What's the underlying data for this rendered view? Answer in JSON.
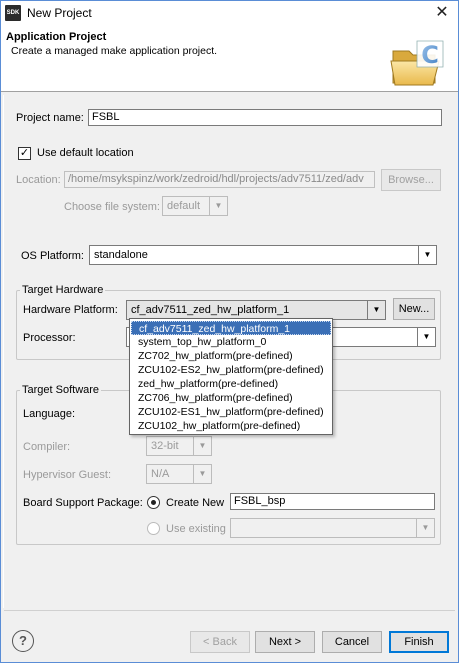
{
  "window": {
    "app_icon_text": "SDK",
    "title": "New Project"
  },
  "header": {
    "title": "Application Project",
    "description": "Create a managed make application project."
  },
  "project": {
    "name_label": "Project name:",
    "name_value": "FSBL",
    "use_default_label": "Use default location",
    "use_default_checked": true,
    "location_label": "Location:",
    "location_value": "/home/msykspinz/work/zedroid/hdl/projects/adv7511/zed/adv",
    "browse_label": "Browse...",
    "filesystem_label": "Choose file system:",
    "filesystem_value": "default"
  },
  "os": {
    "label": "OS Platform:",
    "value": "standalone"
  },
  "target_hardware": {
    "title": "Target Hardware",
    "hw_platform_label": "Hardware Platform:",
    "hw_platform_value": "cf_adv7511_zed_hw_platform_1",
    "new_button": "New...",
    "processor_label": "Processor:",
    "dropdown_options": [
      "cf_adv7511_zed_hw_platform_1",
      "system_top_hw_platform_0",
      "ZC702_hw_platform(pre-defined)",
      "ZCU102-ES2_hw_platform(pre-defined)",
      "zed_hw_platform(pre-defined)",
      "ZC706_hw_platform(pre-defined)",
      "ZCU102-ES1_hw_platform(pre-defined)",
      "ZCU102_hw_platform(pre-defined)"
    ]
  },
  "target_software": {
    "title": "Target Software",
    "language_label": "Language:",
    "compiler_label": "Compiler:",
    "compiler_value": "32-bit",
    "hypervisor_label": "Hypervisor Guest:",
    "hypervisor_value": "N/A",
    "bsp_label": "Board Support Package:",
    "create_new_label": "Create New",
    "bsp_value": "FSBL_bsp",
    "use_existing_label": "Use existing"
  },
  "footer": {
    "help_icon_text": "?",
    "back_label": "< Back",
    "next_label": "Next >",
    "cancel_label": "Cancel",
    "finish_label": "Finish"
  },
  "colors": {
    "selection": "#3b6fb6",
    "window_border": "#5a8dd6",
    "default_button": "#0078d7"
  }
}
